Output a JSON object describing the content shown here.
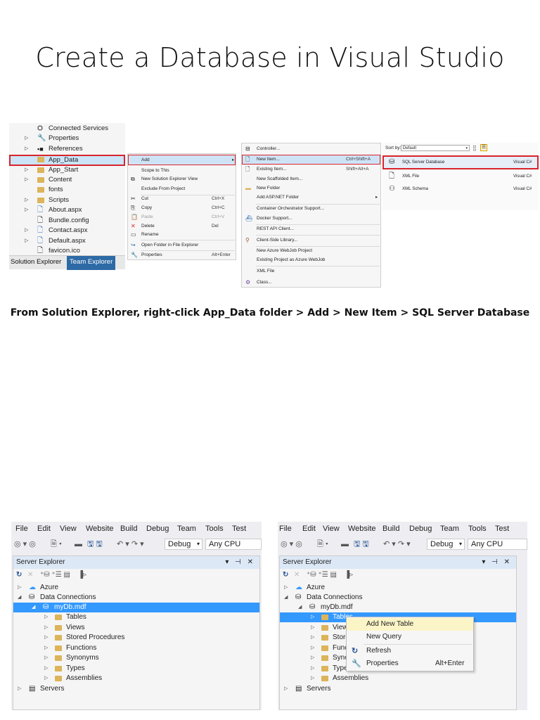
{
  "title": "Create a Database in Visual Studio",
  "caption": "From Solution Explorer, right-click App_Data folder > Add > New Item > SQL Server Database",
  "solution_explorer": {
    "items": [
      {
        "label": "Connected Services",
        "icon": "connected-services-icon"
      },
      {
        "label": "Properties",
        "icon": "wrench-icon"
      },
      {
        "label": "References",
        "icon": "references-icon"
      },
      {
        "label": "App_Data",
        "icon": "folder-icon",
        "selected": true
      },
      {
        "label": "App_Start",
        "icon": "folder-icon"
      },
      {
        "label": "Content",
        "icon": "folder-icon"
      },
      {
        "label": "fonts",
        "icon": "folder-icon"
      },
      {
        "label": "Scripts",
        "icon": "folder-icon"
      },
      {
        "label": "About.aspx",
        "icon": "aspx-file-icon"
      },
      {
        "label": "Bundle.config",
        "icon": "config-file-icon"
      },
      {
        "label": "Contact.aspx",
        "icon": "aspx-file-icon"
      },
      {
        "label": "Default.aspx",
        "icon": "aspx-file-icon"
      },
      {
        "label": "favicon.ico",
        "icon": "ico-file-icon"
      }
    ],
    "tabs": [
      "Solution Explorer",
      "Team Explorer"
    ]
  },
  "context_menu_1": {
    "items": [
      {
        "label": "Add",
        "shortcut": "",
        "highlighted": true
      },
      {
        "label": "Scope to This",
        "shortcut": ""
      },
      {
        "label": "New Solution Explorer View",
        "shortcut": ""
      },
      {
        "label": "Exclude From Project",
        "shortcut": ""
      },
      {
        "label": "Cut",
        "shortcut": "Ctrl+X"
      },
      {
        "label": "Copy",
        "shortcut": "Ctrl+C"
      },
      {
        "label": "Paste",
        "shortcut": "Ctrl+V"
      },
      {
        "label": "Delete",
        "shortcut": "Del"
      },
      {
        "label": "Rename",
        "shortcut": ""
      },
      {
        "label": "Open Folder in File Explorer",
        "shortcut": ""
      },
      {
        "label": "Properties",
        "shortcut": "Alt+Enter"
      }
    ]
  },
  "add_submenu": {
    "items": [
      {
        "label": "Controller...",
        "shortcut": ""
      },
      {
        "label": "New Item...",
        "shortcut": "Ctrl+Shift+A",
        "highlighted": true
      },
      {
        "label": "Existing Item...",
        "shortcut": "Shift+Alt+A"
      },
      {
        "label": "New Scaffolded Item...",
        "shortcut": ""
      },
      {
        "label": "New Folder",
        "shortcut": ""
      },
      {
        "label": "Add ASP.NET Folder",
        "shortcut": ""
      },
      {
        "label": "Container Orchestrator Support...",
        "shortcut": ""
      },
      {
        "label": "Docker Support...",
        "shortcut": ""
      },
      {
        "label": "REST API Client...",
        "shortcut": ""
      },
      {
        "label": "Client-Side Library...",
        "shortcut": ""
      },
      {
        "label": "New Azure WebJob Project",
        "shortcut": ""
      },
      {
        "label": "Existing Project as Azure WebJob",
        "shortcut": ""
      },
      {
        "label": "XML File",
        "shortcut": ""
      },
      {
        "label": "Class...",
        "shortcut": ""
      }
    ]
  },
  "new_item_dialog": {
    "sort_label": "Sort by:",
    "sort_value": "Default",
    "templates": [
      {
        "label": "SQL Server Database",
        "lang": "Visual C#",
        "highlighted": true
      },
      {
        "label": "XML File",
        "lang": "Visual C#"
      },
      {
        "label": "XML Schema",
        "lang": "Visual C#"
      }
    ]
  },
  "vs_window": {
    "menu": [
      "File",
      "Edit",
      "View",
      "Website",
      "Build",
      "Debug",
      "Team",
      "Tools",
      "Test"
    ],
    "config": "Debug",
    "platform": "Any CPU",
    "panel_title": "Server Explorer",
    "tree": [
      {
        "label": "Azure",
        "level": 0,
        "icon": "azure-cloud-icon"
      },
      {
        "label": "Data Connections",
        "level": 0,
        "icon": "data-connections-icon"
      },
      {
        "label": "myDb.mdf",
        "level": 1,
        "icon": "database-icon"
      },
      {
        "label": "Tables",
        "level": 2,
        "icon": "folder-icon"
      },
      {
        "label": "Views",
        "level": 2,
        "icon": "folder-icon"
      },
      {
        "label": "Stored Procedures",
        "level": 2,
        "icon": "folder-icon"
      },
      {
        "label": "Functions",
        "level": 2,
        "icon": "folder-icon"
      },
      {
        "label": "Synonyms",
        "level": 2,
        "icon": "folder-icon"
      },
      {
        "label": "Types",
        "level": 2,
        "icon": "folder-icon"
      },
      {
        "label": "Assemblies",
        "level": 2,
        "icon": "folder-icon"
      },
      {
        "label": "Servers",
        "level": 0,
        "icon": "servers-icon"
      }
    ],
    "truncated_tree": [
      "Azure",
      "Data Connections",
      "myDb.mdf",
      "Tables",
      "Views",
      "Storec",
      "Functi",
      "Synon",
      "Types",
      "Assemblies",
      "Servers"
    ]
  },
  "tables_context_menu": {
    "items": [
      {
        "label": "Add New Table",
        "shortcut": "",
        "highlighted": true
      },
      {
        "label": "New Query",
        "shortcut": ""
      },
      {
        "label": "Refresh",
        "shortcut": ""
      },
      {
        "label": "Properties",
        "shortcut": "Alt+Enter"
      }
    ]
  },
  "colors": {
    "selection": "#3399ff",
    "highlight_border": "#d8242c",
    "folder": "#dcb45a"
  }
}
